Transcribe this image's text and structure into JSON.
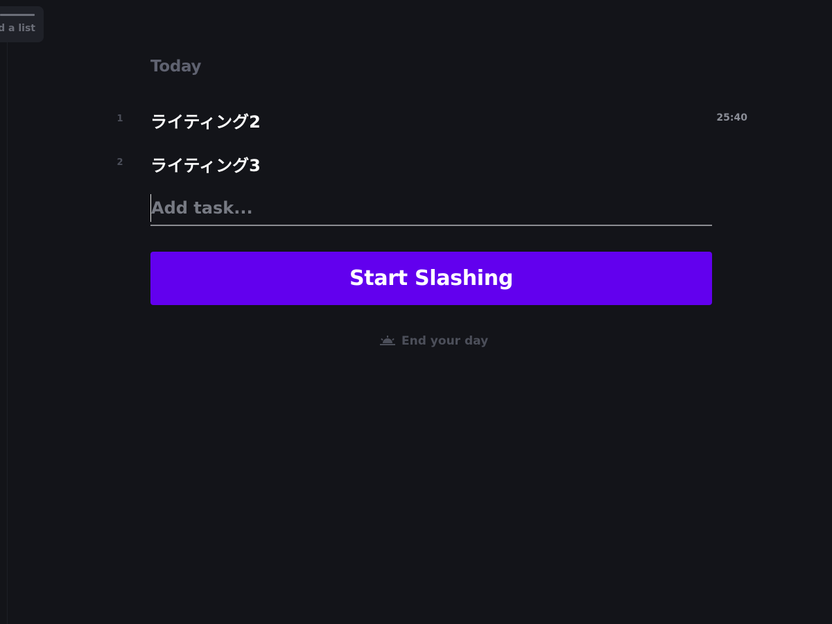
{
  "sidebar": {
    "add_list_label": "d a list"
  },
  "list": {
    "title": "Today",
    "tasks": [
      {
        "number": "1",
        "name": "ライティング2",
        "time": "25:40"
      },
      {
        "number": "2",
        "name": "ライティング3",
        "time": ""
      }
    ],
    "add_task_placeholder": "Add task...",
    "add_task_value": ""
  },
  "actions": {
    "start_label": "Start Slashing",
    "start_color": "#6200ee",
    "end_day_label": "End your day",
    "end_day_icon": "sunset-icon"
  }
}
